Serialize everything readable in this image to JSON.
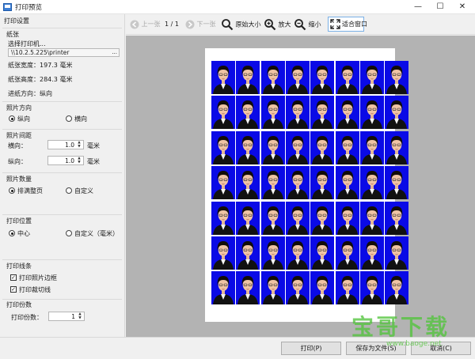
{
  "window": {
    "title": "打印预览",
    "controls": {
      "minimize": "—",
      "maximize": "☐",
      "close": "✕"
    }
  },
  "sidebar": {
    "header": "打印设置",
    "paper": {
      "title": "纸张",
      "select_printer_label": "选择打印机...",
      "printer_path": "\\\\10.2.5.225\\printer",
      "browse_label": "...",
      "width_text": "纸张宽度：197.3 毫米",
      "height_text": "纸张高度：284.3 毫米",
      "feed_text": "进纸方向：纵向"
    },
    "orientation": {
      "title": "照片方向",
      "options": [
        "纵向",
        "横向"
      ],
      "selected": "纵向"
    },
    "spacing": {
      "title": "照片间距",
      "horizontal_label": "横向：",
      "horizontal_value": "1.0",
      "vertical_label": "纵向：",
      "vertical_value": "1.0",
      "unit": "毫米"
    },
    "quantity": {
      "title": "照片数量",
      "options": [
        "排满整页",
        "自定义"
      ],
      "selected": "排满整页"
    },
    "position": {
      "title": "打印位置",
      "options": [
        "中心",
        "自定义（毫米）"
      ],
      "selected": "中心"
    },
    "lines": {
      "title": "打印线条",
      "options": [
        "打印照片边框",
        "打印裁切线"
      ],
      "checked": [
        true,
        true
      ]
    },
    "copies": {
      "title": "打印份数",
      "label": "打印份数：",
      "value": "1"
    }
  },
  "toolbar": {
    "prev_label": "上一张",
    "page_indicator": "1 / 1",
    "next_label": "下一张",
    "original_size_label": "原始大小",
    "zoom_in_label": "放大",
    "zoom_out_label": "缩小",
    "fit_window_label": "适合窗口"
  },
  "preview": {
    "photo_columns": 8,
    "photo_rows": 7,
    "photo_background": "#0a0ae6"
  },
  "bottom": {
    "print_label": "打印(P)",
    "save_label": "保存为文件(S)",
    "cancel_label": "取消(C)"
  },
  "watermark": {
    "main": "宝哥下载",
    "sub": "www.baoge.net"
  },
  "colors": {
    "accent": "#0078d7",
    "watermark": "#52c43c",
    "preview_bg": "#b3b3b3"
  }
}
